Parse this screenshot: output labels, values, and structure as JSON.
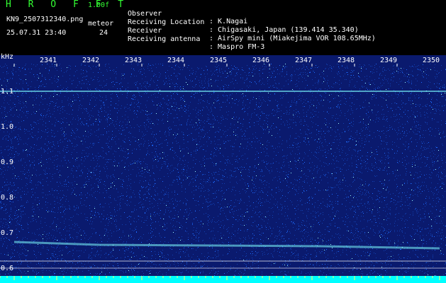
{
  "header": {
    "app_title": "H R O F F T",
    "version": "1.00f",
    "filename": "KN9_2507312340.png",
    "meteor_label": "meteor",
    "datetime": "25.07.31 23:40",
    "meteor_count": "24",
    "info": [
      {
        "label": "Observer",
        "value": ": K.Nagai"
      },
      {
        "label": "Receiving Location",
        "value": ": Chigasaki, Japan (139.414 35.340)"
      },
      {
        "label": "Receiver",
        "value": ": AirSpy mini (Miakejima VOR 108.65MHz)"
      },
      {
        "label": "Receiving antenna",
        "value": ": Maspro FM-3"
      }
    ]
  },
  "spectrogram": {
    "unit_label": "kHz",
    "y_labels": [
      "1.1",
      "1.0",
      "0.9",
      "0.8",
      "0.7",
      "0.6"
    ],
    "x_labels": [
      "2341",
      "2342",
      "2343",
      "2344",
      "2345",
      "2346",
      "2347",
      "2348",
      "2349",
      "2350"
    ],
    "colors": {
      "background": "#0a1a6e",
      "noise": "#1e6bff",
      "signal": "#7fffff",
      "bottom_bar": "#00ffff"
    }
  }
}
